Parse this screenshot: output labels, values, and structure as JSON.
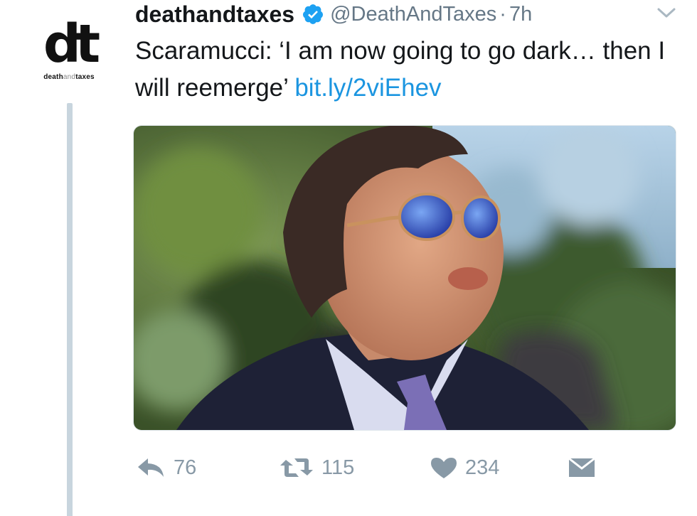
{
  "account": {
    "avatar_mark": "dt",
    "avatar_word_left": "death",
    "avatar_word_mid": "and",
    "avatar_word_right": "taxes",
    "display_name": "deathandtaxes",
    "handle": "@DeathAndTaxes",
    "separator": "·",
    "timestamp": "7h",
    "verified": true
  },
  "tweet": {
    "text": "Scaramucci: ‘I am now going to go dark… then I will reemerge’ ",
    "link": "bit.ly/2viEhev"
  },
  "actions": {
    "reply_icon": "reply-icon",
    "reply_count": "76",
    "retweet_icon": "retweet-icon",
    "retweet_count": "115",
    "like_icon": "heart-icon",
    "like_count": "234",
    "dm_icon": "envelope-icon"
  },
  "colors": {
    "link": "#1b95e0",
    "muted": "#8899a6",
    "verified": "#1da1f2",
    "thread_line": "#c8d5de"
  }
}
